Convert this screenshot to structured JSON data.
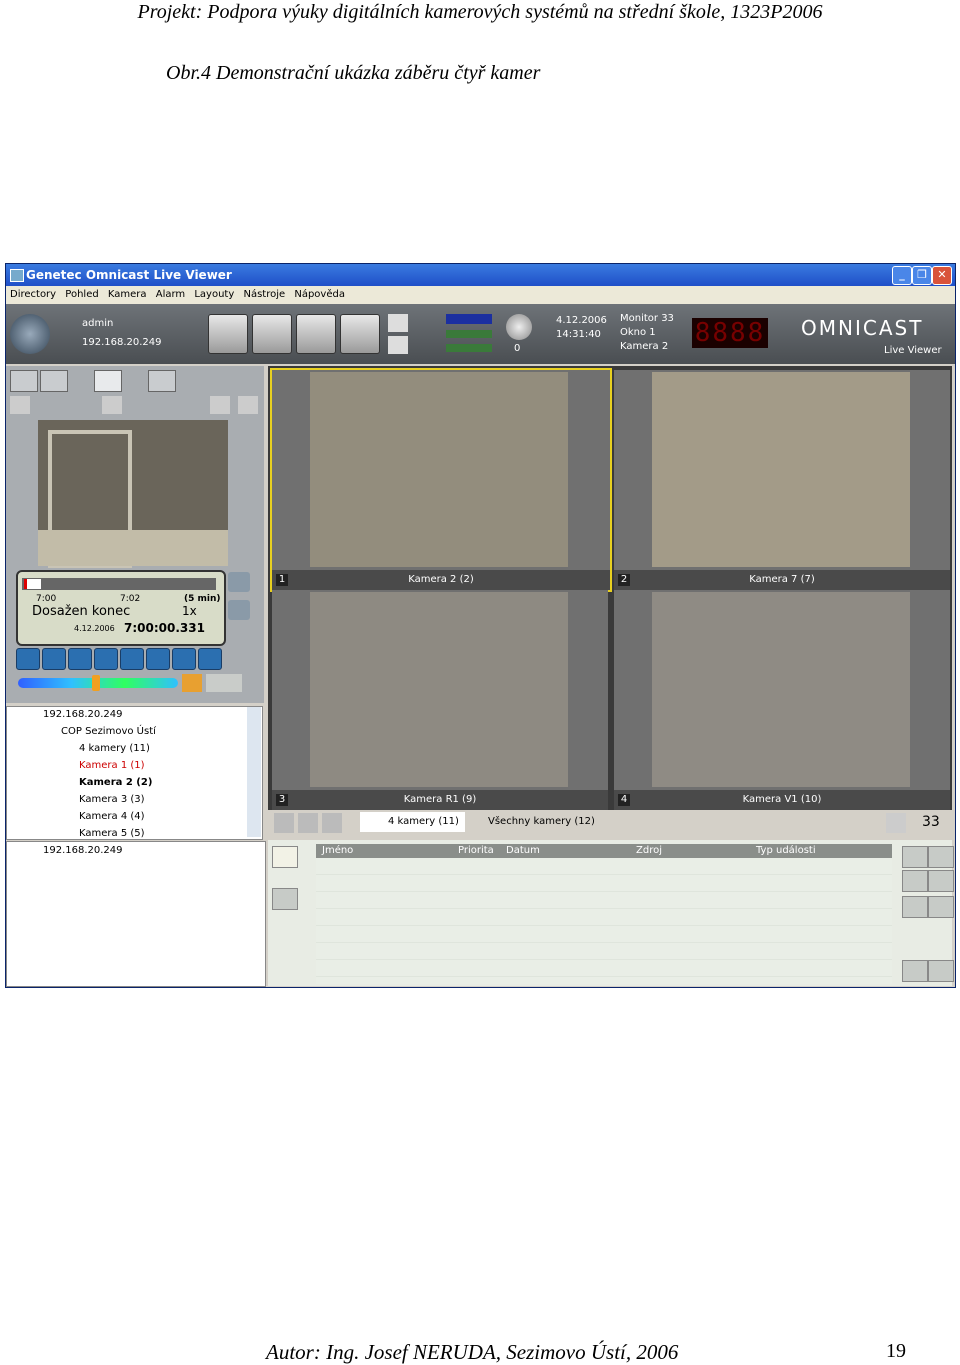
{
  "page": {
    "header": "Projekt: Podpora výuky digitálních kamerových systémů na střední škole, 1323P2006",
    "caption": "Obr.4 Demonstrační ukázka záběru čtyř kamer",
    "footer": "Autor: Ing. Josef NERUDA, Sezimovo Ústí, 2006",
    "page_number": "19"
  },
  "app": {
    "title": "Genetec Omnicast Live Viewer",
    "menu": [
      "Directory",
      "Pohled",
      "Kamera",
      "Alarm",
      "Layouty",
      "Nástroje",
      "Nápověda"
    ],
    "user": "admin",
    "ip": "192.168.20.249",
    "counter": "0",
    "date": "4.12.2006",
    "time": "14:31:40",
    "monitor": "Monitor 33",
    "window": "Okno 1",
    "camera": "Kamera 2",
    "led": "8888",
    "logo": "OMNICAST",
    "logo_sub": "Live Viewer"
  },
  "player": {
    "t_start": "7:00",
    "t_end": "7:02",
    "range": "(5 min)",
    "status": "Dosažen konec",
    "speed": "1x",
    "date": "4.12.2006",
    "timestamp": "7:00:00.331"
  },
  "tree": {
    "root": "192.168.20.249",
    "site": "COP Sezimovo Ústí",
    "items": [
      "4 kamery (11)",
      "Kamera 1 (1)",
      "Kamera 2 (2)",
      "Kamera 3 (3)",
      "Kamera 4 (4)",
      "Kamera 5 (5)"
    ]
  },
  "tree2": {
    "root": "192.168.20.249"
  },
  "tiles": [
    {
      "num": "1",
      "name": "Kamera 2 (2)"
    },
    {
      "num": "2",
      "name": "Kamera 7 (7)"
    },
    {
      "num": "3",
      "name": "Kamera R1 (9)"
    },
    {
      "num": "4",
      "name": "Kamera V1 (10)"
    }
  ],
  "views": {
    "tab1": "4 kamery (11)",
    "tab2": "Všechny kamery (12)",
    "count": "33"
  },
  "events": {
    "columns": [
      "Jméno",
      "Priorita",
      "Datum",
      "Zdroj",
      "Typ události"
    ]
  }
}
